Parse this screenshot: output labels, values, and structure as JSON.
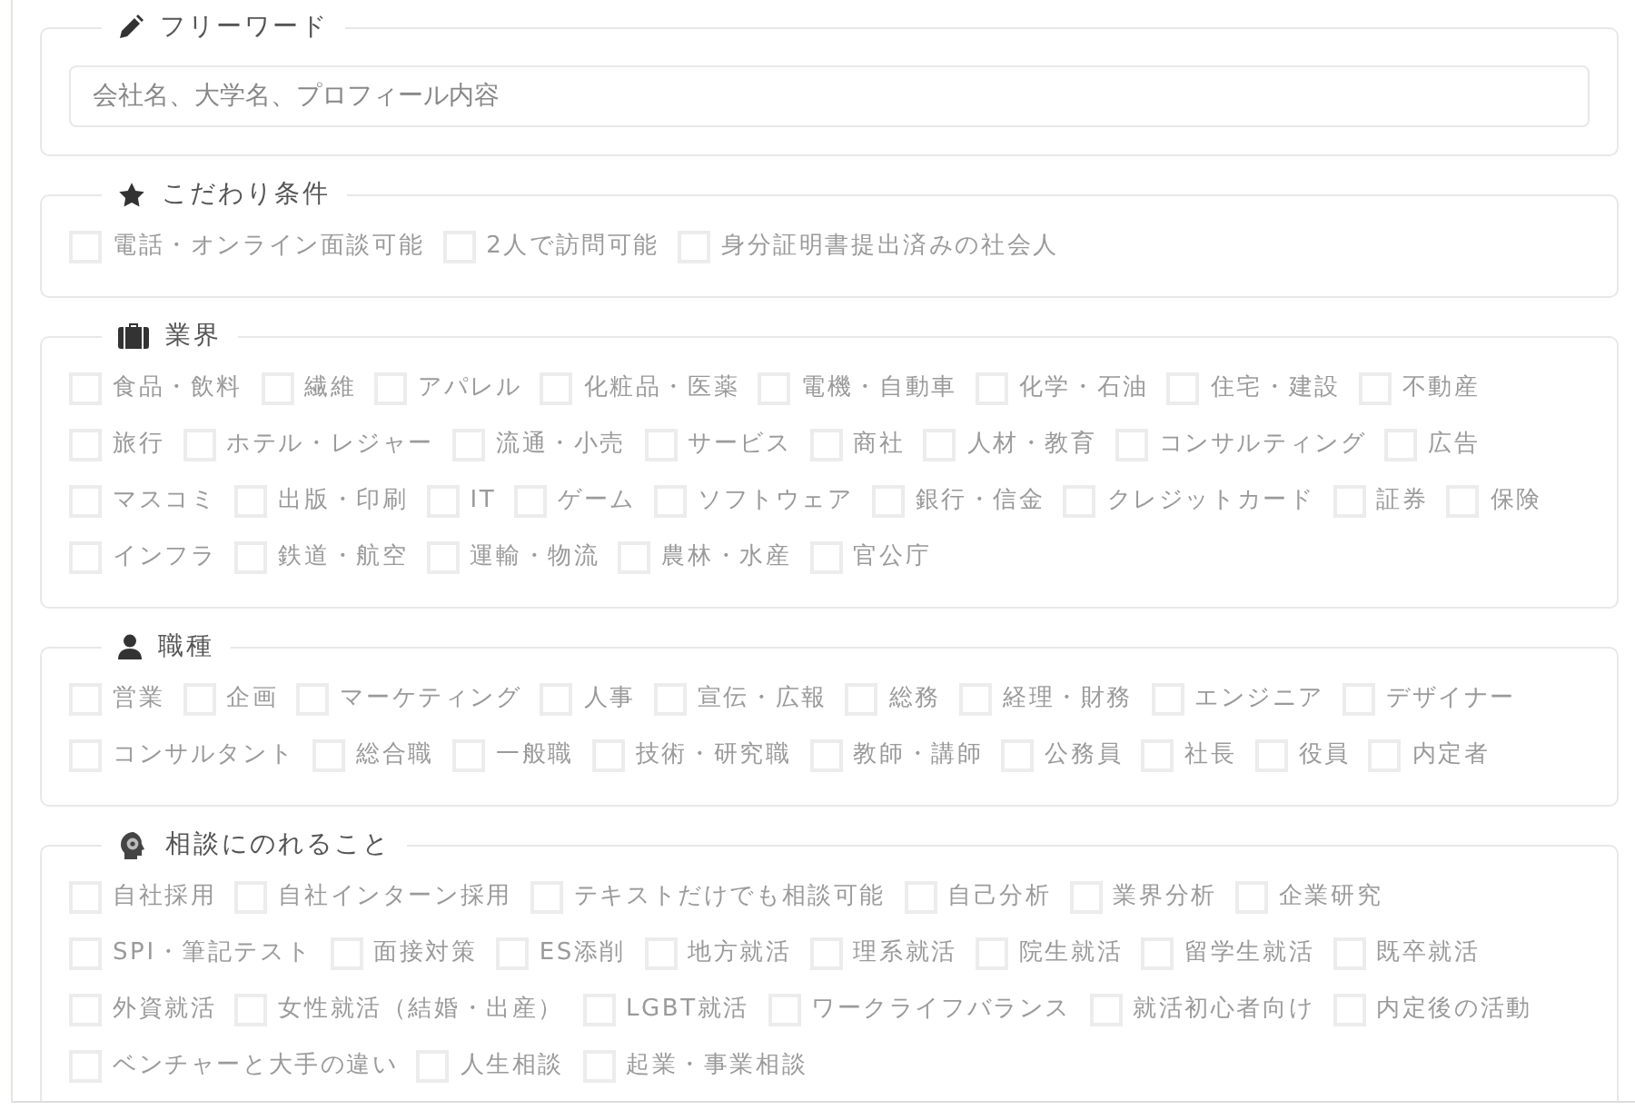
{
  "sections": [
    {
      "title": "フリーワード",
      "kind": "text",
      "placeholder": "会社名、大学名、プロフィール内容"
    },
    {
      "title": "こだわり条件",
      "kind": "checks",
      "options": [
        {
          "label": "電話・オンライン面談可能",
          "checked": false
        },
        {
          "label": "2人で訪問可能",
          "checked": false
        },
        {
          "label": "身分証明書提出済みの社会人",
          "checked": false
        }
      ]
    },
    {
      "title": "業界",
      "kind": "checks",
      "options": [
        {
          "label": "食品・飲料",
          "checked": false
        },
        {
          "label": "繊維",
          "checked": false
        },
        {
          "label": "アパレル",
          "checked": false
        },
        {
          "label": "化粧品・医薬",
          "checked": false
        },
        {
          "label": "電機・自動車",
          "checked": false
        },
        {
          "label": "化学・石油",
          "checked": false
        },
        {
          "label": "住宅・建設",
          "checked": false
        },
        {
          "label": "不動産",
          "checked": false
        },
        {
          "label": "旅行",
          "checked": false
        },
        {
          "label": "ホテル・レジャー",
          "checked": false
        },
        {
          "label": "流通・小売",
          "checked": false
        },
        {
          "label": "サービス",
          "checked": false
        },
        {
          "label": "商社",
          "checked": false
        },
        {
          "label": "人材・教育",
          "checked": false
        },
        {
          "label": "コンサルティング",
          "checked": false
        },
        {
          "label": "広告",
          "checked": false
        },
        {
          "label": "マスコミ",
          "checked": false
        },
        {
          "label": "出版・印刷",
          "checked": false
        },
        {
          "label": "IT",
          "checked": false
        },
        {
          "label": "ゲーム",
          "checked": false
        },
        {
          "label": "ソフトウェア",
          "checked": false
        },
        {
          "label": "銀行・信金",
          "checked": false
        },
        {
          "label": "クレジットカード",
          "checked": false
        },
        {
          "label": "証券",
          "checked": false
        },
        {
          "label": "保険",
          "checked": false
        },
        {
          "label": "インフラ",
          "checked": false
        },
        {
          "label": "鉄道・航空",
          "checked": false
        },
        {
          "label": "運輸・物流",
          "checked": false
        },
        {
          "label": "農林・水産",
          "checked": false
        },
        {
          "label": "官公庁",
          "checked": false
        }
      ]
    },
    {
      "title": "職種",
      "kind": "checks",
      "options": [
        {
          "label": "営業",
          "checked": false
        },
        {
          "label": "企画",
          "checked": false
        },
        {
          "label": "マーケティング",
          "checked": false
        },
        {
          "label": "人事",
          "checked": false
        },
        {
          "label": "宣伝・広報",
          "checked": false
        },
        {
          "label": "総務",
          "checked": false
        },
        {
          "label": "経理・財務",
          "checked": false
        },
        {
          "label": "エンジニア",
          "checked": false
        },
        {
          "label": "デザイナー",
          "checked": false
        },
        {
          "label": "コンサルタント",
          "checked": false
        },
        {
          "label": "総合職",
          "checked": false
        },
        {
          "label": "一般職",
          "checked": false
        },
        {
          "label": "技術・研究職",
          "checked": false
        },
        {
          "label": "教師・講師",
          "checked": false
        },
        {
          "label": "公務員",
          "checked": false
        },
        {
          "label": "社長",
          "checked": false
        },
        {
          "label": "役員",
          "checked": false
        },
        {
          "label": "内定者",
          "checked": false
        }
      ]
    },
    {
      "title": "相談にのれること",
      "kind": "checks",
      "options": [
        {
          "label": "自社採用",
          "checked": false
        },
        {
          "label": "自社インターン採用",
          "checked": false
        },
        {
          "label": "テキストだけでも相談可能",
          "checked": false
        },
        {
          "label": "自己分析",
          "checked": false
        },
        {
          "label": "業界分析",
          "checked": false
        },
        {
          "label": "企業研究",
          "checked": false
        },
        {
          "label": "SPI・筆記テスト",
          "checked": false
        },
        {
          "label": "面接対策",
          "checked": false
        },
        {
          "label": "ES添削",
          "checked": false
        },
        {
          "label": "地方就活",
          "checked": false
        },
        {
          "label": "理系就活",
          "checked": false
        },
        {
          "label": "院生就活",
          "checked": false
        },
        {
          "label": "留学生就活",
          "checked": false
        },
        {
          "label": "既卒就活",
          "checked": false
        },
        {
          "label": "外資就活",
          "checked": false
        },
        {
          "label": "女性就活（結婚・出産）",
          "checked": false
        },
        {
          "label": "LGBT就活",
          "checked": false
        },
        {
          "label": "ワークライフバランス",
          "checked": false
        },
        {
          "label": "就活初心者向け",
          "checked": false
        },
        {
          "label": "内定後の活動",
          "checked": false
        },
        {
          "label": "ベンチャーと大手の違い",
          "checked": false
        },
        {
          "label": "人生相談",
          "checked": false
        },
        {
          "label": "起業・事業相談",
          "checked": false
        }
      ]
    }
  ]
}
